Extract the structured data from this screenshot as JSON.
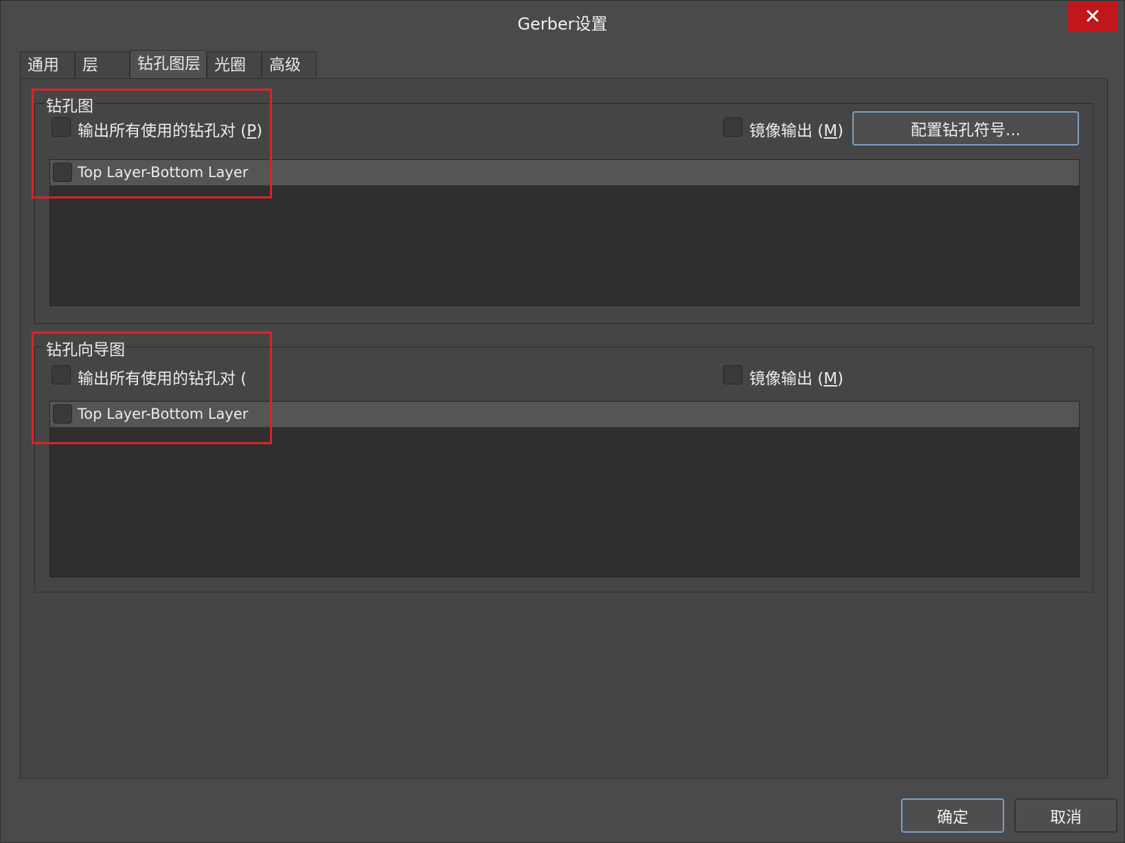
{
  "window": {
    "title": "Gerber设置",
    "close_glyph": "✕"
  },
  "tabs": [
    {
      "label": "通用"
    },
    {
      "label": "层"
    },
    {
      "label": "钻孔图层"
    },
    {
      "label": "光圈"
    },
    {
      "label": "高级"
    }
  ],
  "active_tab": "钻孔图层",
  "drill_drawing": {
    "title": "钻孔图",
    "output_all_pairs_label": "输出所有使用的钻孔对 (",
    "output_all_pairs_hotkey": "P",
    "output_all_pairs_close": ")",
    "mirror_label": "镜像输出 (",
    "mirror_hotkey": "M",
    "mirror_close": ")",
    "config_button": "配置钻孔符号...",
    "layer_pairs": [
      {
        "name": "Top Layer-Bottom Layer",
        "checked": false
      }
    ]
  },
  "drill_guide": {
    "title": "钻孔向导图",
    "output_all_pairs_label": "输出所有使用的钻孔对 (",
    "mirror_label": "镜像输出 (",
    "mirror_hotkey": "M",
    "mirror_close": ")",
    "layer_pairs": [
      {
        "name": "Top Layer-Bottom Layer",
        "checked": false
      }
    ]
  },
  "footer": {
    "ok_label": "确定",
    "cancel_label": "取消"
  },
  "colors": {
    "highlight_box": "#e0212a",
    "close_button": "#c0171c",
    "focus_border": "#7da3c8"
  }
}
